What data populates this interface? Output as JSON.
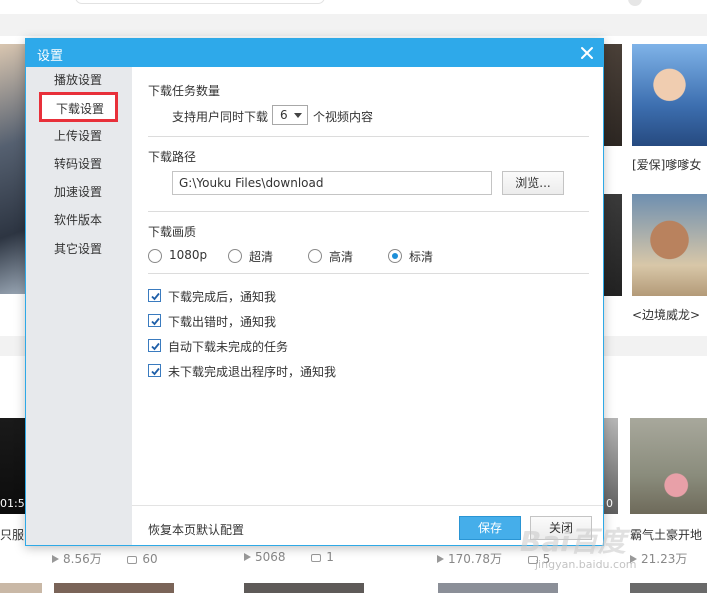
{
  "background": {
    "items": [
      {
        "title": "[爱保]嗲嗲女"
      },
      {
        "title": "<边境威龙>"
      },
      {
        "title": "只服"
      },
      {
        "title": "霸气土豪开地"
      }
    ],
    "times": [
      "01:5",
      "0"
    ],
    "stats": [
      {
        "plays": "8.56万",
        "comments": "60"
      },
      {
        "plays": "5068",
        "comments": "1"
      },
      {
        "plays": "170.78万",
        "comments": "5"
      },
      {
        "plays": "21.23万"
      }
    ],
    "watermark": "Bai百度",
    "watermark_sub": "jingyan.baidu.com"
  },
  "dialog": {
    "title": "设置",
    "sidebar": [
      {
        "label": "播放设置",
        "active": false
      },
      {
        "label": "下载设置",
        "active": true
      },
      {
        "label": "上传设置",
        "active": false
      },
      {
        "label": "转码设置",
        "active": false
      },
      {
        "label": "加速设置",
        "active": false
      },
      {
        "label": "软件版本",
        "active": false
      },
      {
        "label": "其它设置",
        "active": false
      }
    ],
    "task_count": {
      "title": "下载任务数量",
      "prefix": "支持用户同时下载",
      "value": "6",
      "suffix": "个视频内容"
    },
    "path": {
      "title": "下载路径",
      "value": "G:\\Youku Files\\download",
      "browse_label": "浏览..."
    },
    "quality": {
      "title": "下载画质",
      "options": [
        {
          "label": "1080p",
          "selected": false
        },
        {
          "label": "超清",
          "selected": false
        },
        {
          "label": "高清",
          "selected": false
        },
        {
          "label": "标清",
          "selected": true
        }
      ]
    },
    "checkboxes": [
      {
        "label": "下载完成后，通知我",
        "checked": true
      },
      {
        "label": "下载出错时，通知我",
        "checked": true
      },
      {
        "label": "自动下载未完成的任务",
        "checked": true
      },
      {
        "label": "未下载完成退出程序时，通知我",
        "checked": true
      }
    ],
    "footer": {
      "restore_label": "恢复本页默认配置",
      "save_label": "保存",
      "close_label": "关闭"
    }
  }
}
